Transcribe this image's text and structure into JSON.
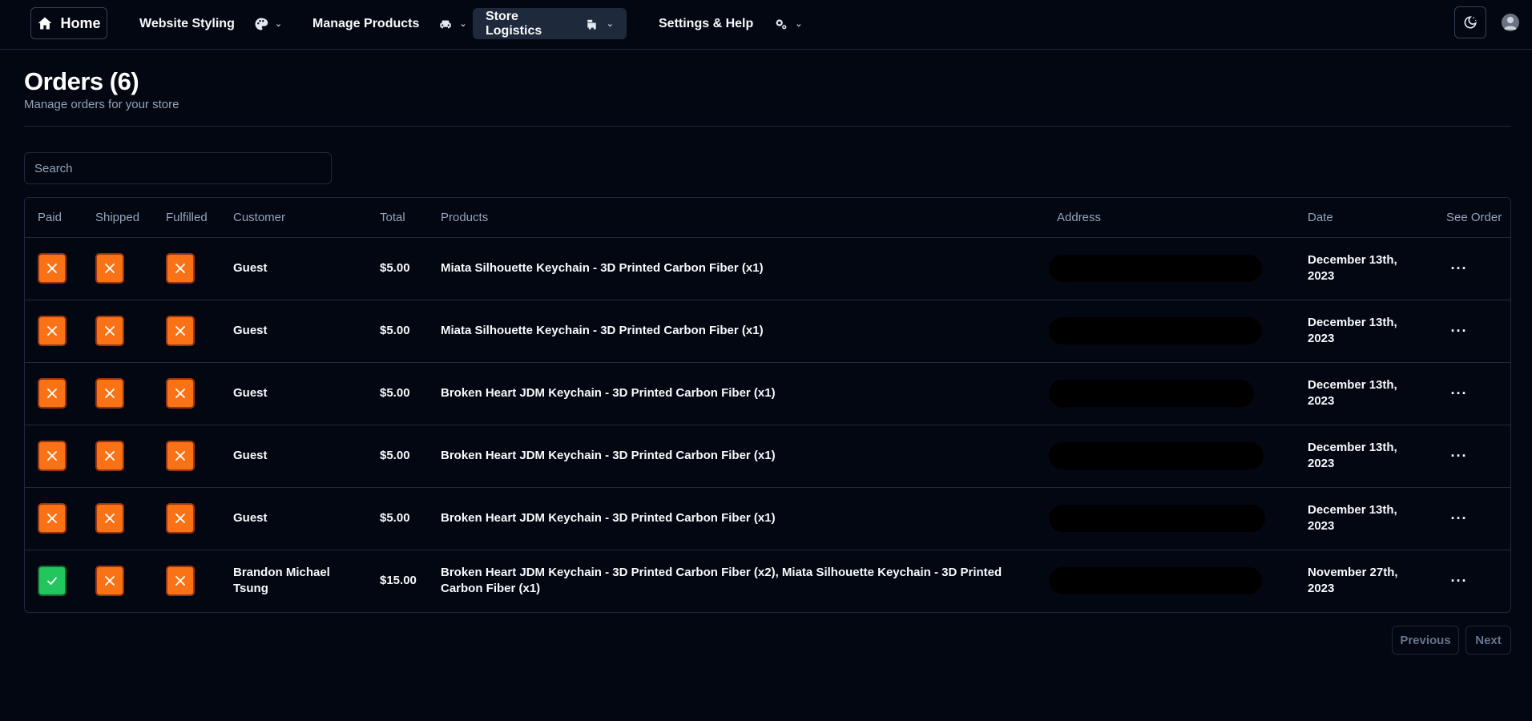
{
  "nav": {
    "home_label": "Home",
    "items": [
      {
        "label": "Website Styling",
        "icon": "palette-icon",
        "chevron": "⌄"
      },
      {
        "label": "Manage Products",
        "icon": "car-icon",
        "chevron": "⌄"
      },
      {
        "label": "Store Logistics",
        "icon": "truck-icon",
        "chevron": "⌄",
        "active": true
      },
      {
        "label": "Settings & Help",
        "icon": "gears-icon",
        "chevron": "⌄"
      }
    ],
    "theme_icon": "moon-stars-icon",
    "avatar_icon": "user-avatar-icon"
  },
  "header": {
    "title": "Orders (6)",
    "subtitle": "Manage orders for your store"
  },
  "search": {
    "placeholder": "Search",
    "value": ""
  },
  "table": {
    "columns": [
      "Paid",
      "Shipped",
      "Fulfilled",
      "Customer",
      "Total",
      "Products",
      "Address",
      "Date",
      "See Order"
    ],
    "rows": [
      {
        "paid": false,
        "shipped": false,
        "fulfilled": false,
        "customer": "Guest",
        "total": "$5.00",
        "products": "Miata Silhouette Keychain - 3D Printed Carbon Fiber (x1)",
        "address": "",
        "date": "December 13th, 2023"
      },
      {
        "paid": false,
        "shipped": false,
        "fulfilled": false,
        "customer": "Guest",
        "total": "$5.00",
        "products": "Miata Silhouette Keychain - 3D Printed Carbon Fiber (x1)",
        "address": "",
        "date": "December 13th, 2023"
      },
      {
        "paid": false,
        "shipped": false,
        "fulfilled": false,
        "customer": "Guest",
        "total": "$5.00",
        "products": "Broken Heart JDM Keychain - 3D Printed Carbon Fiber (x1)",
        "address": "",
        "date": "December 13th, 2023"
      },
      {
        "paid": false,
        "shipped": false,
        "fulfilled": false,
        "customer": "Guest",
        "total": "$5.00",
        "products": "Broken Heart JDM Keychain - 3D Printed Carbon Fiber (x1)",
        "address": "",
        "date": "December 13th, 2023"
      },
      {
        "paid": false,
        "shipped": false,
        "fulfilled": false,
        "customer": "Guest",
        "total": "$5.00",
        "products": "Broken Heart JDM Keychain - 3D Printed Carbon Fiber (x1)",
        "address": "",
        "date": "December 13th, 2023"
      },
      {
        "paid": true,
        "shipped": false,
        "fulfilled": false,
        "customer": "Brandon Michael Tsung",
        "total": "$15.00",
        "products": "Broken Heart JDM Keychain - 3D Printed Carbon Fiber (x2), Miata Silhouette Keychain - 3D Printed Carbon Fiber (x1)",
        "address": "",
        "date": "November 27th, 2023"
      }
    ],
    "more_label": "···"
  },
  "status_icons": {
    "no": "x-icon",
    "yes": "check-icon"
  },
  "colors": {
    "background": "#030712",
    "unpaid_orange": "#f97316",
    "paid_green": "#22c55e",
    "active_nav": "#1e293b"
  },
  "pagination": {
    "previous_label": "Previous",
    "next_label": "Next"
  }
}
